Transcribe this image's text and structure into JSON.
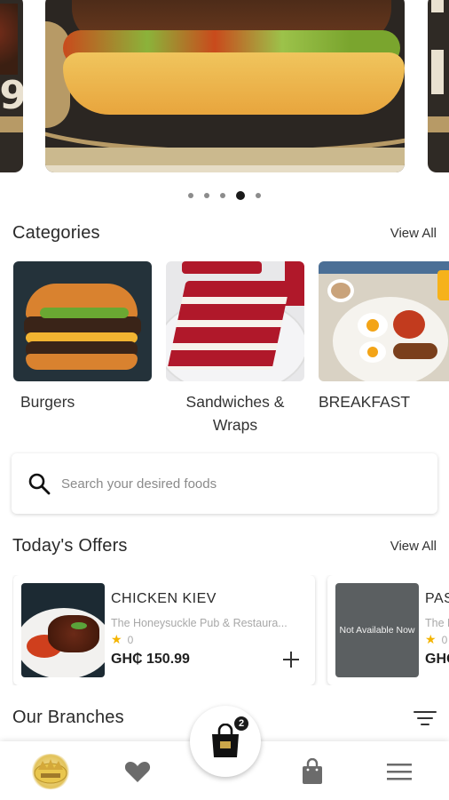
{
  "banner": {
    "dots": [
      false,
      false,
      false,
      true,
      false
    ],
    "left_slide_text": "9"
  },
  "categories": {
    "title": "Categories",
    "view_all": "View All",
    "items": [
      {
        "label": "Burgers"
      },
      {
        "label": "Sandwiches & Wraps"
      },
      {
        "label": "BREAKFAST"
      }
    ]
  },
  "search": {
    "placeholder": "Search your desired foods"
  },
  "offers": {
    "title": "Today's Offers",
    "view_all": "View All",
    "items": [
      {
        "name": "CHICKEN KIEV",
        "restaurant": "The Honeysuckle Pub & Restaura...",
        "rating": "0",
        "price": "GH₵ 150.99"
      },
      {
        "name": "PAS",
        "restaurant": "The H",
        "rating": "0",
        "price": "GH₵",
        "image_text": "Not Available Now"
      }
    ]
  },
  "branches": {
    "title": "Our Branches"
  },
  "cart": {
    "count": "2"
  },
  "colors": {
    "accent_gold": "#b79a66",
    "star": "#f4b400",
    "dark": "#1a1a1a"
  }
}
